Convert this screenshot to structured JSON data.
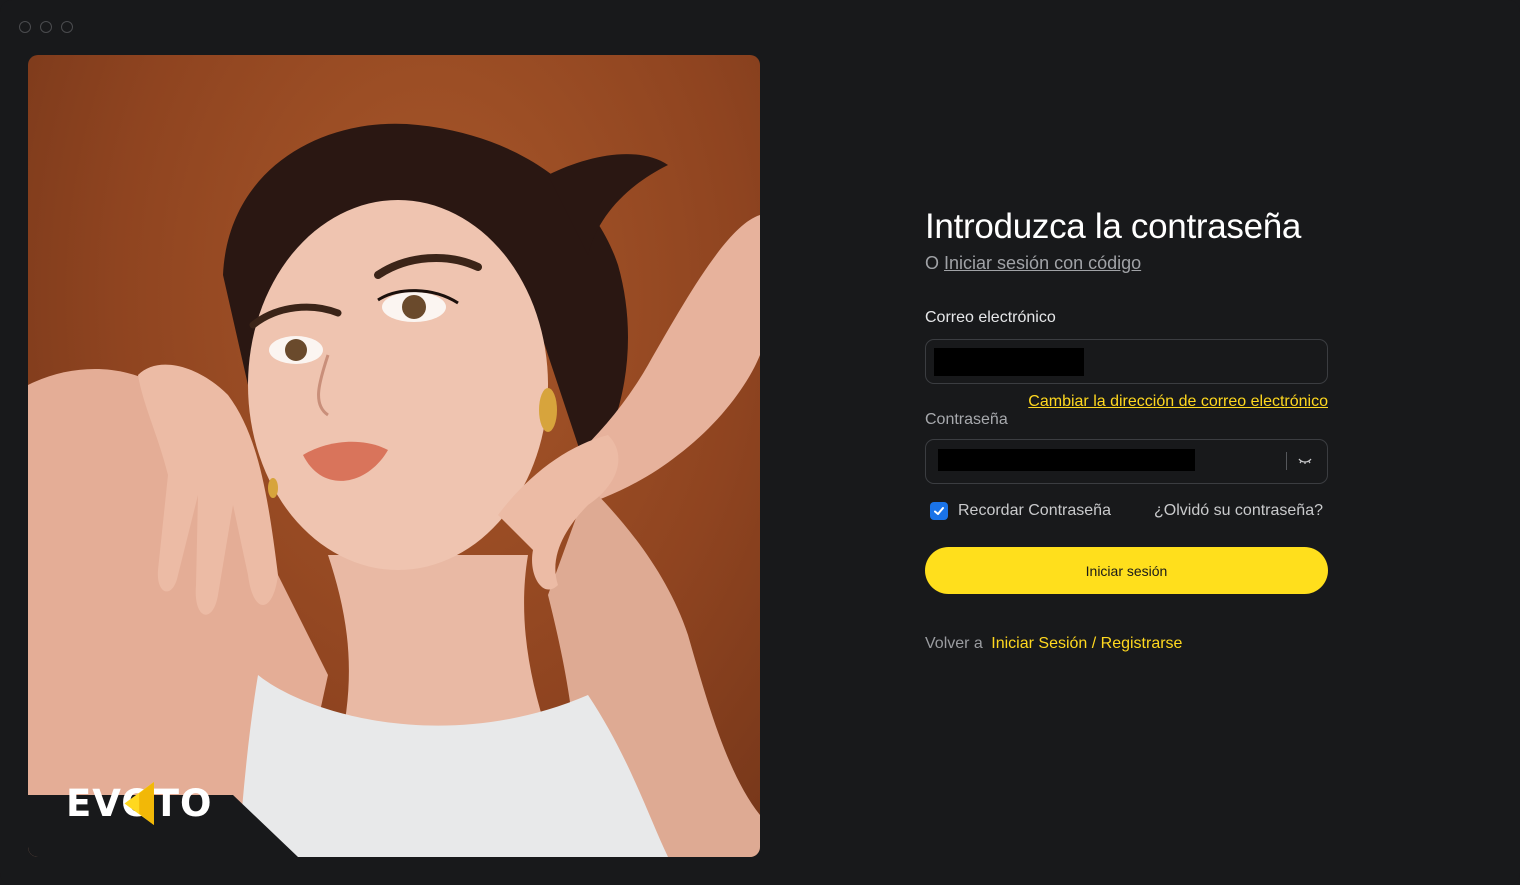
{
  "window": {
    "controls": [
      "close",
      "minimize",
      "maximize"
    ]
  },
  "hero": {
    "brand": "EVOTO",
    "brand_color": "#ffd81f"
  },
  "form": {
    "title": "Introduzca la contraseña",
    "subtitle_prefix": "O",
    "subtitle_link": "Iniciar sesión con código",
    "email_label": "Correo electrónico",
    "email_value": "",
    "change_email_link": "Cambiar la dirección de correo electrónico",
    "password_label": "Contraseña",
    "password_value": "",
    "remember_label": "Recordar Contraseña",
    "remember_checked": true,
    "forgot_link": "¿Olvidó su contraseña?",
    "submit_label": "Iniciar sesión",
    "back_prefix": "Volver a",
    "back_link": "Iniciar Sesión / Registrarse"
  },
  "colors": {
    "accent": "#ffdf1c",
    "link": "#ffd81f",
    "checkbox": "#1a73e8",
    "background": "#18191b"
  },
  "icons": {
    "password_toggle": "eye-closed-icon",
    "checkbox": "check-icon"
  }
}
